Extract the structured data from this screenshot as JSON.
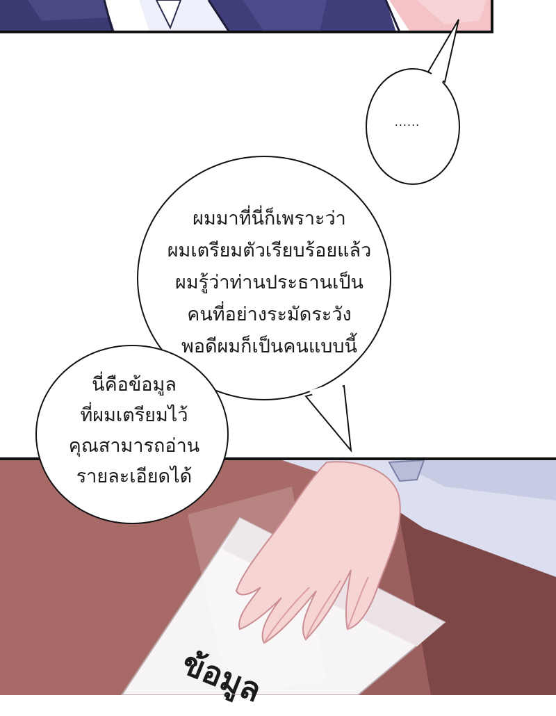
{
  "panels": {
    "top": {
      "description_colors": {
        "suit": "#3f3e78",
        "shirt": "#eef0fb",
        "skin": "#f4c7cc"
      }
    },
    "bottom": {
      "description_colors": {
        "desk": "#9a5e5c",
        "paper": "#f7f4f6",
        "hand": "#f6d2d3"
      }
    }
  },
  "bubbles": {
    "ellipsis": {
      "text": "......"
    },
    "main": {
      "lines": [
        "ผมมาที่นี่ก็เพราะว่า",
        "ผมเตรียมตัวเรียบร้อยแล้ว",
        "ผมรู้ว่าท่านประธานเป็น",
        "คนที่อย่างระมัดระวัง",
        "พอดีผมก็เป็นคนแบบนี้"
      ]
    },
    "info": {
      "lines": [
        "นี่คือข้อมูล",
        "ที่ผมเตรียมไว้",
        "คุณสามารถอ่าน",
        "รายละเอียดได้"
      ]
    }
  },
  "document": {
    "text": "ข้อมูล"
  }
}
